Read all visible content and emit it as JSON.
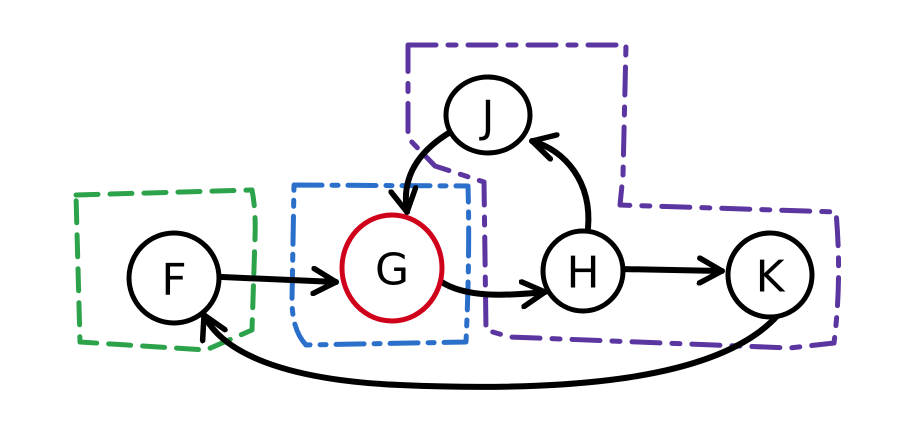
{
  "colors": {
    "ink": "#000000",
    "highlight": "#d0021b",
    "group_green": "#2ca24a",
    "group_blue": "#2a6fc9",
    "group_purple": "#5b35a0"
  },
  "nodes": {
    "F": {
      "label": "F"
    },
    "G": {
      "label": "G",
      "highlighted": true
    },
    "H": {
      "label": "H"
    },
    "J": {
      "label": "J"
    },
    "K": {
      "label": "K"
    }
  },
  "edges": [
    {
      "from": "F",
      "to": "G"
    },
    {
      "from": "G",
      "to": "H"
    },
    {
      "from": "H",
      "to": "J"
    },
    {
      "from": "J",
      "to": "G"
    },
    {
      "from": "H",
      "to": "K"
    },
    {
      "from": "K",
      "to": "F"
    }
  ],
  "groups": [
    {
      "color": "green",
      "members": [
        "F"
      ]
    },
    {
      "color": "blue",
      "members": [
        "G"
      ]
    },
    {
      "color": "purple",
      "members": [
        "J",
        "H",
        "K"
      ]
    }
  ]
}
